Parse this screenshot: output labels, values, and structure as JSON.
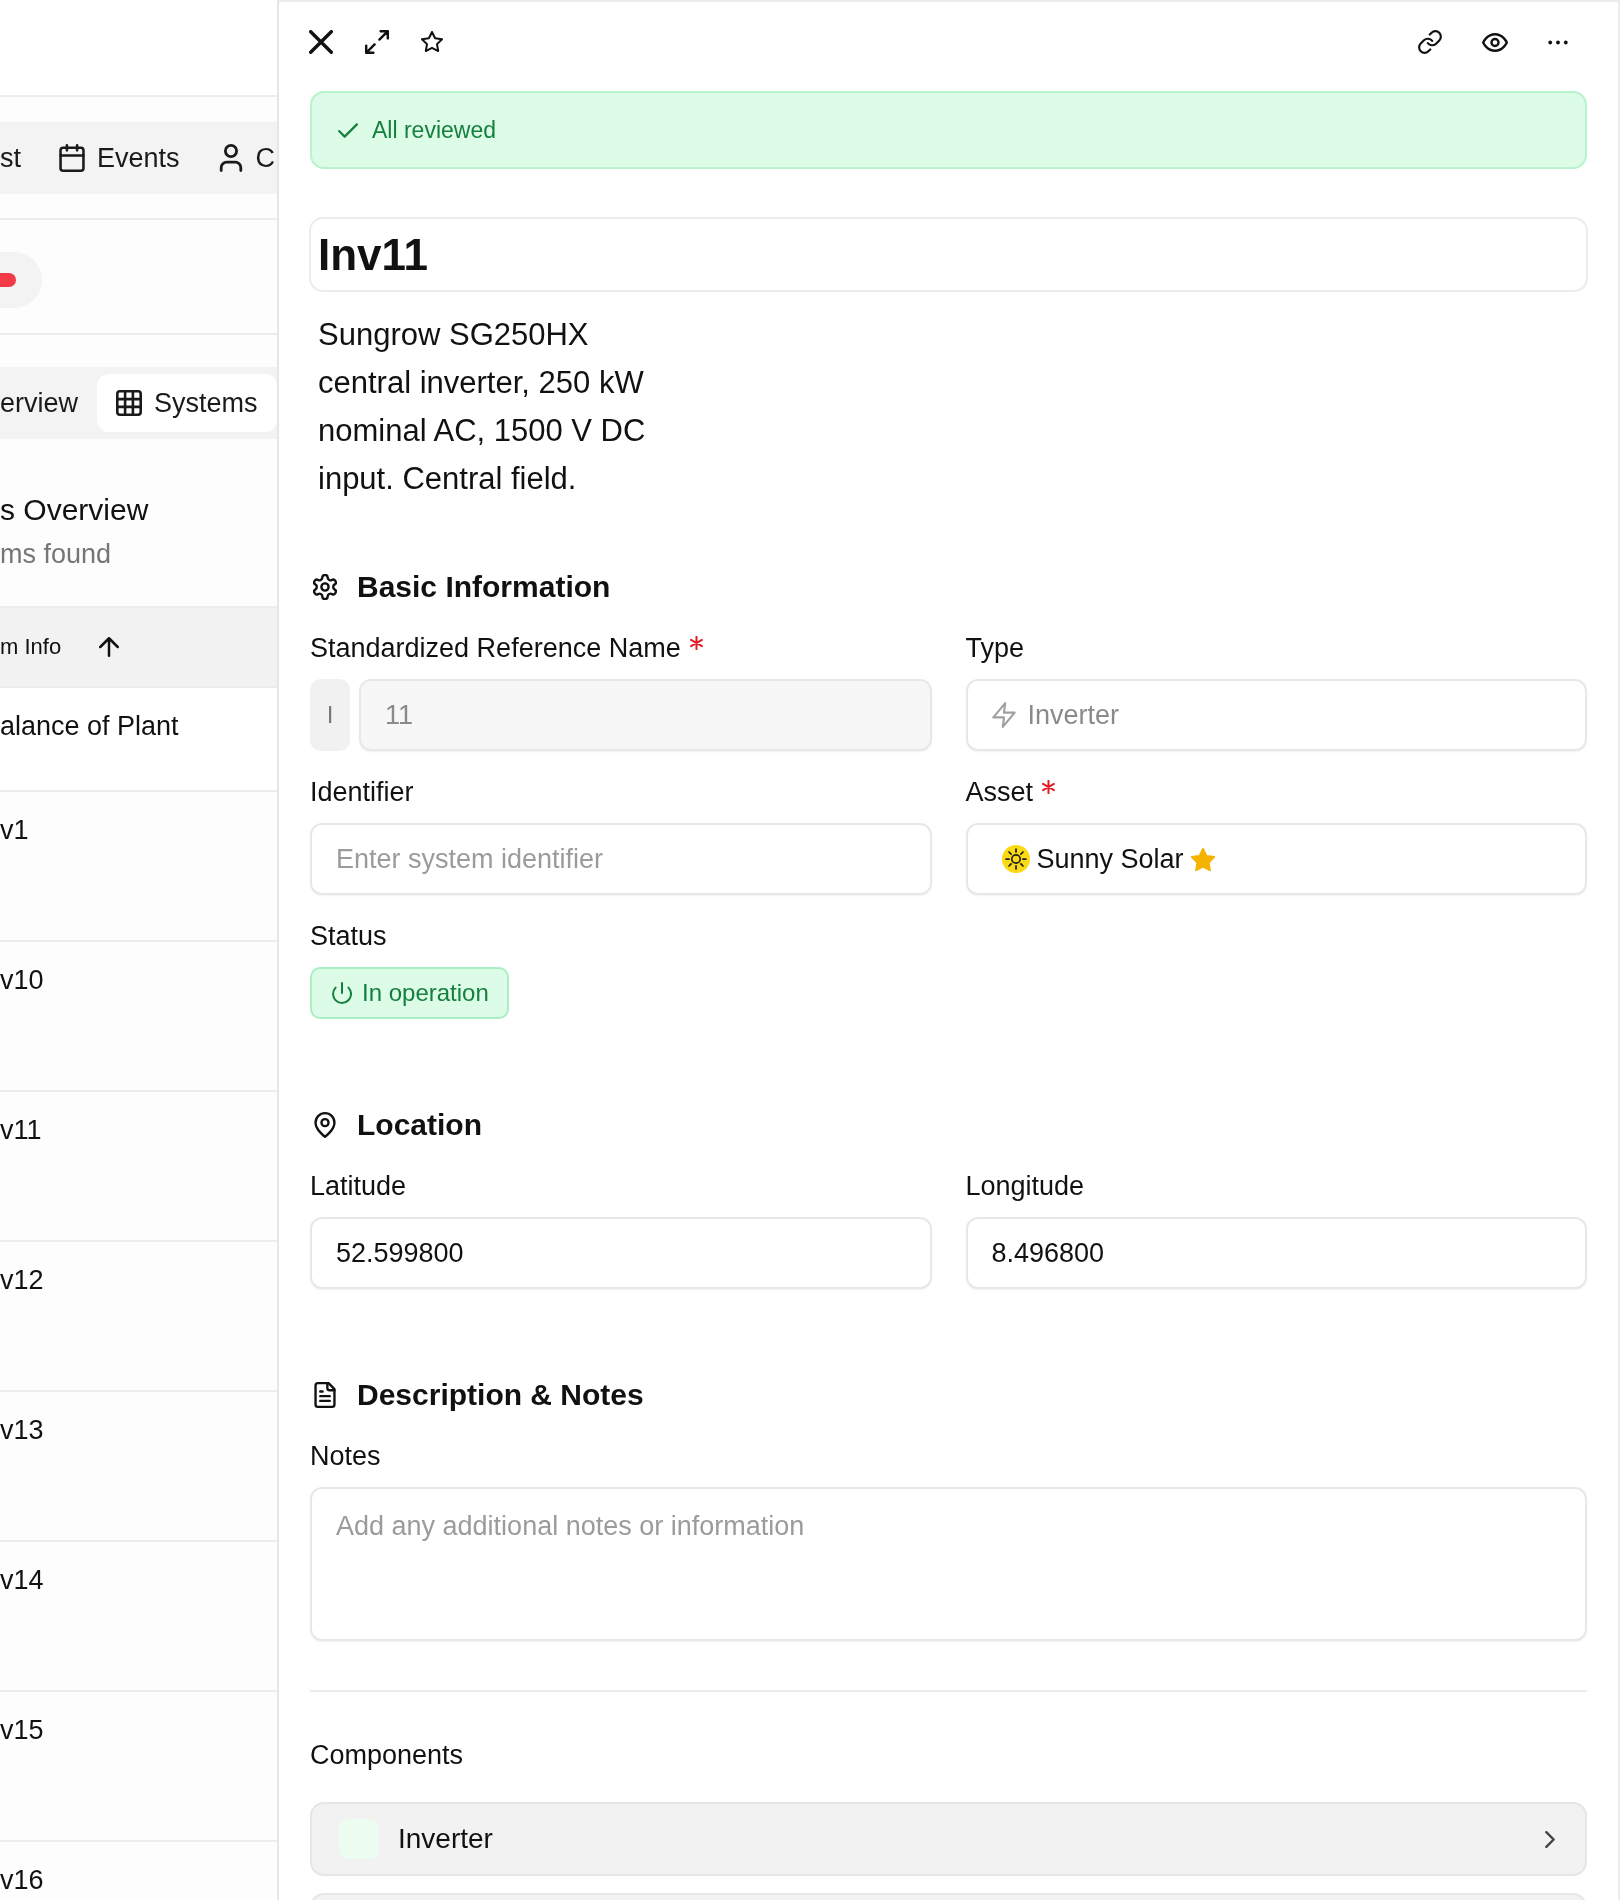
{
  "list_view": {
    "view_tabs": [
      {
        "label": "st",
        "selected": false
      },
      {
        "label": "Events",
        "selected": false
      },
      {
        "label": "C",
        "selected": false
      }
    ],
    "section_tabs": [
      {
        "label": "erview",
        "selected": false
      },
      {
        "label": "Systems",
        "selected": true
      }
    ],
    "heading": "s Overview",
    "count": "ms found",
    "table": {
      "columns": [
        {
          "label": "m Info",
          "sort_ascending": true
        }
      ],
      "rows": [
        {
          "cell": "alance of Plant",
          "kind": "group"
        },
        {
          "cell": "v1",
          "kind": "item"
        },
        {
          "cell": "v10",
          "kind": "item"
        },
        {
          "cell": "v11",
          "kind": "item"
        },
        {
          "cell": "v12",
          "kind": "item"
        },
        {
          "cell": "v13",
          "kind": "item"
        },
        {
          "cell": "v14",
          "kind": "item"
        },
        {
          "cell": "v15",
          "kind": "item"
        },
        {
          "cell": "v16",
          "kind": "item"
        }
      ]
    }
  },
  "detail": {
    "banner": {
      "kind": "success",
      "text": "All reviewed"
    },
    "title": "Inv11",
    "description": "Sungrow SG250HX central inverter, 250 kW nominal AC, 1500 V DC input. Central field.",
    "sections": [
      {
        "heading": "Basic Information",
        "fields": [
          {
            "kind": "prefixed",
            "label": "Standardized Reference Name",
            "required": true,
            "disabled": true,
            "prefix": "I",
            "value": "11"
          },
          {
            "kind": "select",
            "label": "Type",
            "required": false,
            "disabled": true,
            "value": "Inverter"
          },
          {
            "kind": "text",
            "label": "Identifier",
            "required": false,
            "disabled": false,
            "placeholder": "Enter system identifier"
          },
          {
            "kind": "asset",
            "label": "Asset",
            "required": true,
            "disabled": false,
            "value": "Sunny Solar",
            "starred": true
          },
          {
            "kind": "status",
            "label": "Status",
            "required": false,
            "disabled": false,
            "value": "In operation"
          }
        ]
      },
      {
        "heading": "Location",
        "fields": [
          {
            "kind": "text",
            "label": "Latitude",
            "required": false,
            "disabled": false,
            "value": "52.599800"
          },
          {
            "kind": "text",
            "label": "Longitude",
            "required": false,
            "disabled": false,
            "value": "8.496800"
          }
        ]
      },
      {
        "heading": "Description & Notes",
        "fields": [
          {
            "kind": "textarea",
            "label": "Notes",
            "required": false,
            "disabled": false,
            "placeholder": "Add any additional notes or information"
          }
        ]
      }
    ],
    "components": {
      "heading": "Components",
      "items": [
        {
          "name": "Inverter"
        }
      ]
    }
  }
}
